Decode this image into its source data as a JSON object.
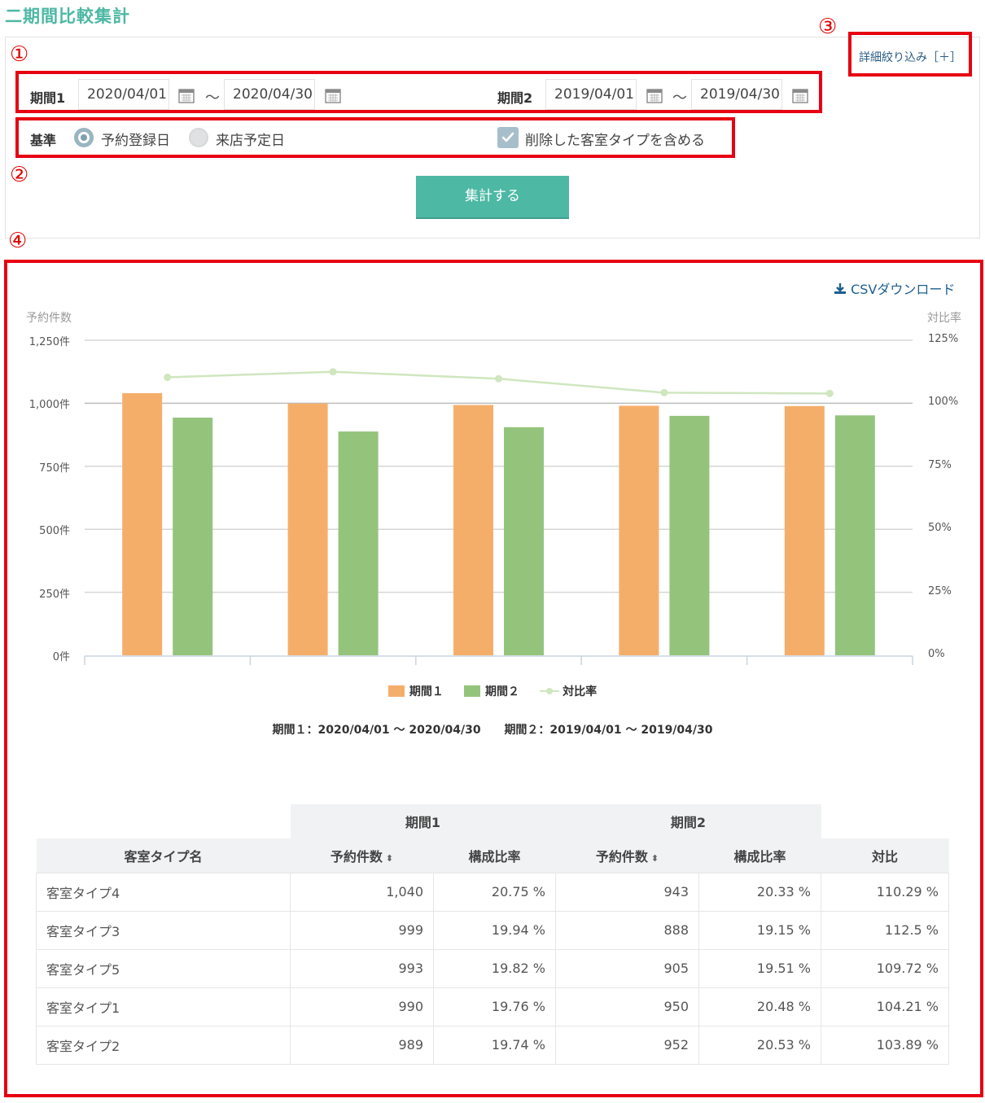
{
  "page": {
    "title": "二期間比較集計"
  },
  "callouts": [
    "①",
    "②",
    "③",
    "④"
  ],
  "filters": {
    "period1_label": "期間1",
    "period1_start": "2020/04/01",
    "period1_end": "2020/04/30",
    "period2_label": "期間2",
    "period2_start": "2019/04/01",
    "period2_end": "2019/04/30",
    "range_separator": "～",
    "basis_label": "基準",
    "basis_options": [
      {
        "label": "予約登録日",
        "selected": true
      },
      {
        "label": "来店予定日",
        "selected": false
      }
    ],
    "include_deleted_label": "削除した客室タイプを含める",
    "include_deleted_checked": true,
    "submit_label": "集計する",
    "detail_link": "詳細絞り込み［＋］"
  },
  "results": {
    "csv_label": "CSVダウンロード",
    "period_note_1": "期間１：2020/04/01 ～ 2020/04/30",
    "period_note_2": "期間２：2019/04/01 ～ 2019/04/30"
  },
  "chart_data": {
    "type": "bar",
    "left_axis_title": "予約件数",
    "right_axis_title": "対比率",
    "left_ticks": [
      "0件",
      "250件",
      "500件",
      "750件",
      "1,000件",
      "1,250件"
    ],
    "right_ticks": [
      "0%",
      "25%",
      "50%",
      "75%",
      "100%",
      "125%"
    ],
    "ylim": [
      0,
      1250
    ],
    "y2lim": [
      0,
      125
    ],
    "categories": [
      "客室タイプ4",
      "客室タイプ3",
      "客室タイプ5",
      "客室タイプ1",
      "客室タイプ2"
    ],
    "series": [
      {
        "name": "期間１",
        "type": "bar",
        "axis": "left",
        "color": "#f5ae6a",
        "values": [
          1040,
          999,
          993,
          990,
          989
        ]
      },
      {
        "name": "期間２",
        "type": "bar",
        "axis": "left",
        "color": "#94c47c",
        "values": [
          943,
          888,
          905,
          950,
          952
        ]
      },
      {
        "name": "対比率",
        "type": "line",
        "axis": "right",
        "color": "#cfe6bf",
        "values": [
          110.29,
          112.5,
          109.72,
          104.21,
          103.89
        ]
      }
    ],
    "grid": true,
    "legend_position": "bottom"
  },
  "table": {
    "group_headers": [
      "期間1",
      "期間2"
    ],
    "headers": [
      "客室タイプ名",
      "予約件数",
      "構成比率",
      "予約件数",
      "構成比率",
      "対比"
    ],
    "sort_icon": "⬍",
    "rows": [
      [
        "客室タイプ4",
        "1,040",
        "20.75 %",
        "943",
        "20.33 %",
        "110.29 %"
      ],
      [
        "客室タイプ3",
        "999",
        "19.94 %",
        "888",
        "19.15 %",
        "112.5 %"
      ],
      [
        "客室タイプ5",
        "993",
        "19.82 %",
        "905",
        "19.51 %",
        "109.72 %"
      ],
      [
        "客室タイプ1",
        "990",
        "19.76 %",
        "950",
        "20.48 %",
        "104.21 %"
      ],
      [
        "客室タイプ2",
        "989",
        "19.74 %",
        "952",
        "20.53 %",
        "103.89 %"
      ]
    ]
  }
}
